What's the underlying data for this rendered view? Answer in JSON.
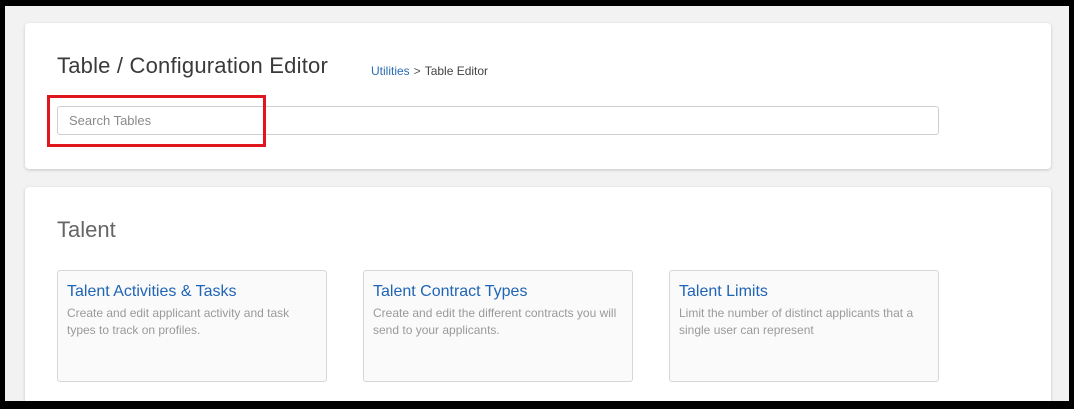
{
  "header": {
    "title": "Table / Configuration Editor",
    "breadcrumb": {
      "link": "Utilities",
      "separator": ">",
      "current": "Table Editor"
    }
  },
  "search": {
    "placeholder": "Search Tables",
    "value": ""
  },
  "section": {
    "title": "Talent",
    "tiles": [
      {
        "title": "Talent Activities & Tasks",
        "description": "Create and edit applicant activity and task types to track on profiles."
      },
      {
        "title": "Talent Contract Types",
        "description": "Create and edit the different contracts you will send to your applicants."
      },
      {
        "title": "Talent Limits",
        "description": "Limit the number of distinct applicants that a single user can represent"
      }
    ]
  },
  "colors": {
    "link": "#1f64b5",
    "highlight": "#e0161f",
    "background": "#f2f2f2"
  }
}
